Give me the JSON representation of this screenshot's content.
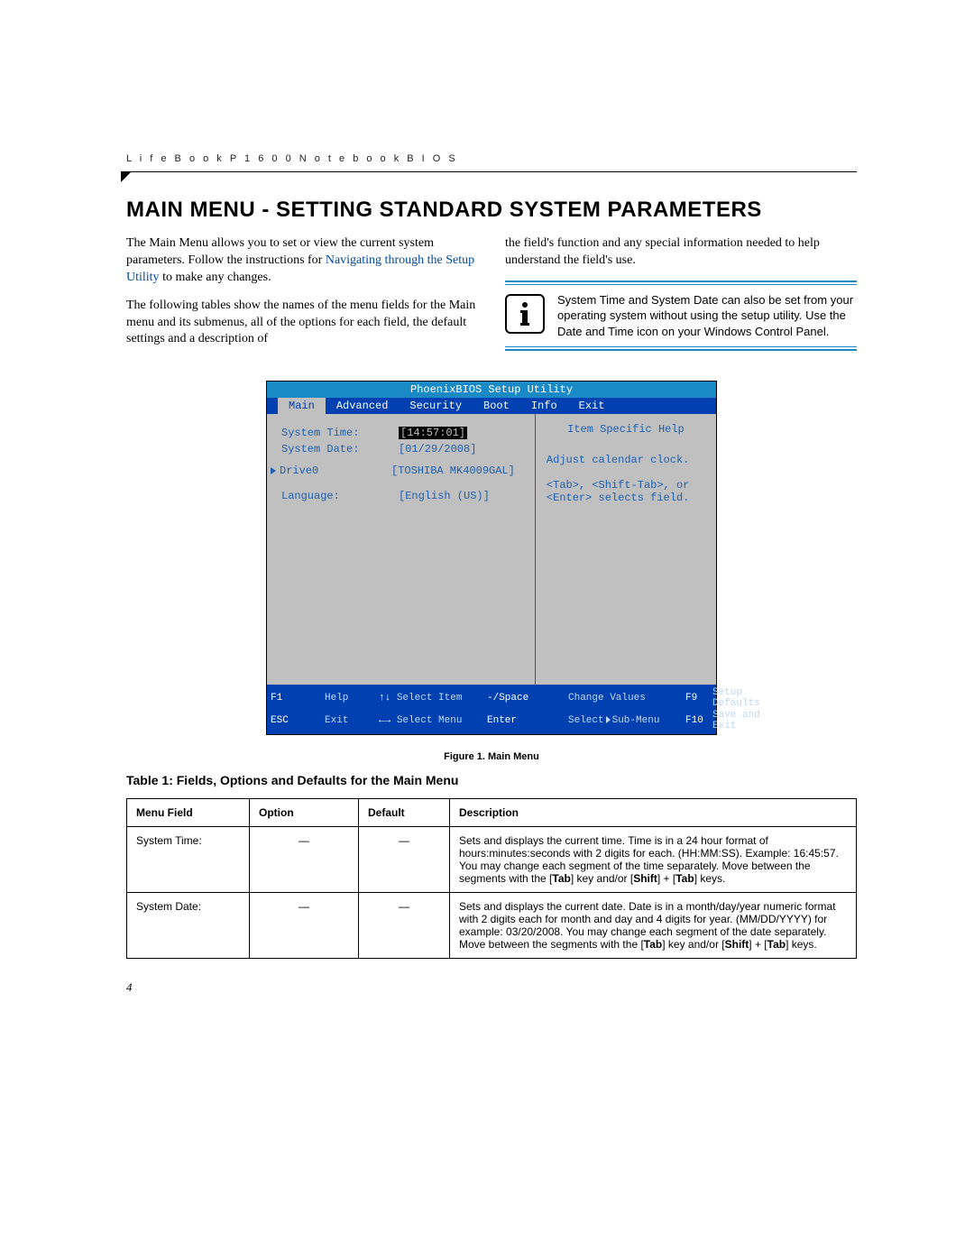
{
  "header": {
    "running_head": "L i f e B o o k   P 1 6 0 0   N o t e b o o k   B I O S"
  },
  "title": "MAIN MENU - SETTING STANDARD SYSTEM PARAMETERS",
  "col_left": {
    "p1_a": "The Main Menu allows you to set or view the current system parameters. Follow the instructions for ",
    "p1_link": "Navigating through the Setup Utility",
    "p1_b": " to make any changes.",
    "p2": "The following tables show the names of the menu fields for the Main menu and its submenus, all of the options for each field, the default settings and a description of"
  },
  "col_right": {
    "p1": "the field's function and any special information needed to help understand the field's use.",
    "note": "System Time and System Date can also be set from your operating system without using the setup utility. Use the Date and Time icon on your Windows Control Panel."
  },
  "bios": {
    "title": "PhoenixBIOS Setup Utility",
    "menu": [
      "Main",
      "Advanced",
      "Security",
      "Boot",
      "Info",
      "Exit"
    ],
    "rows": {
      "time_label": "System Time:",
      "time_value": "[14:57:01]",
      "date_label": "System Date:",
      "date_value": "[01/29/2008]",
      "drive_label": "Drive0",
      "drive_value": "[TOSHIBA MK4009GAL]",
      "lang_label": "Language:",
      "lang_value": "[English (US)]"
    },
    "help": {
      "title": "Item Specific Help",
      "l1": "Adjust calendar clock.",
      "l2": "<Tab>, <Shift-Tab>, or",
      "l3": "<Enter> selects field."
    },
    "footer": {
      "f1": "F1",
      "help": "Help",
      "arrows_v": "↑↓",
      "sel_item": "Select Item",
      "minus": "-/Space",
      "chg": "Change Values",
      "f9": "F9",
      "defaults": "Setup Defaults",
      "esc": "ESC",
      "exit": "Exit",
      "arrows_h": "←→",
      "sel_menu": "Select Menu",
      "enter": "Enter",
      "sub": "Select",
      "sub2": "Sub-Menu",
      "f10": "F10",
      "save": "Save and Exit"
    }
  },
  "figure_caption": "Figure 1.  Main Menu",
  "table": {
    "title": "Table 1: Fields, Options and Defaults for the Main Menu",
    "headers": [
      "Menu Field",
      "Option",
      "Default",
      "Description"
    ],
    "rows": [
      {
        "field": "System Time:",
        "option": "—",
        "default": "—",
        "desc_parts": [
          "Sets and displays the current time. Time is in a 24 hour format of hours:minutes:seconds with 2 digits for each. (HH:MM:SS). Example: 16:45:57. You may change each segment of the time separately. Move between the segments with the [",
          "Tab",
          "] key and/or [",
          "Shift",
          "] + [",
          "Tab",
          "] keys."
        ]
      },
      {
        "field": "System Date:",
        "option": "—",
        "default": "—",
        "desc_parts": [
          "Sets and displays the current date. Date is in a month/day/year numeric format with 2 digits each for month and day and 4 digits for year. (MM/DD/YYYY) for example: 03/20/2008. You may change each segment of the date separately. Move between the segments with the [",
          "Tab",
          "] key and/or [",
          "Shift",
          "] + [",
          "Tab",
          "] keys."
        ]
      }
    ]
  },
  "page_number": "4"
}
